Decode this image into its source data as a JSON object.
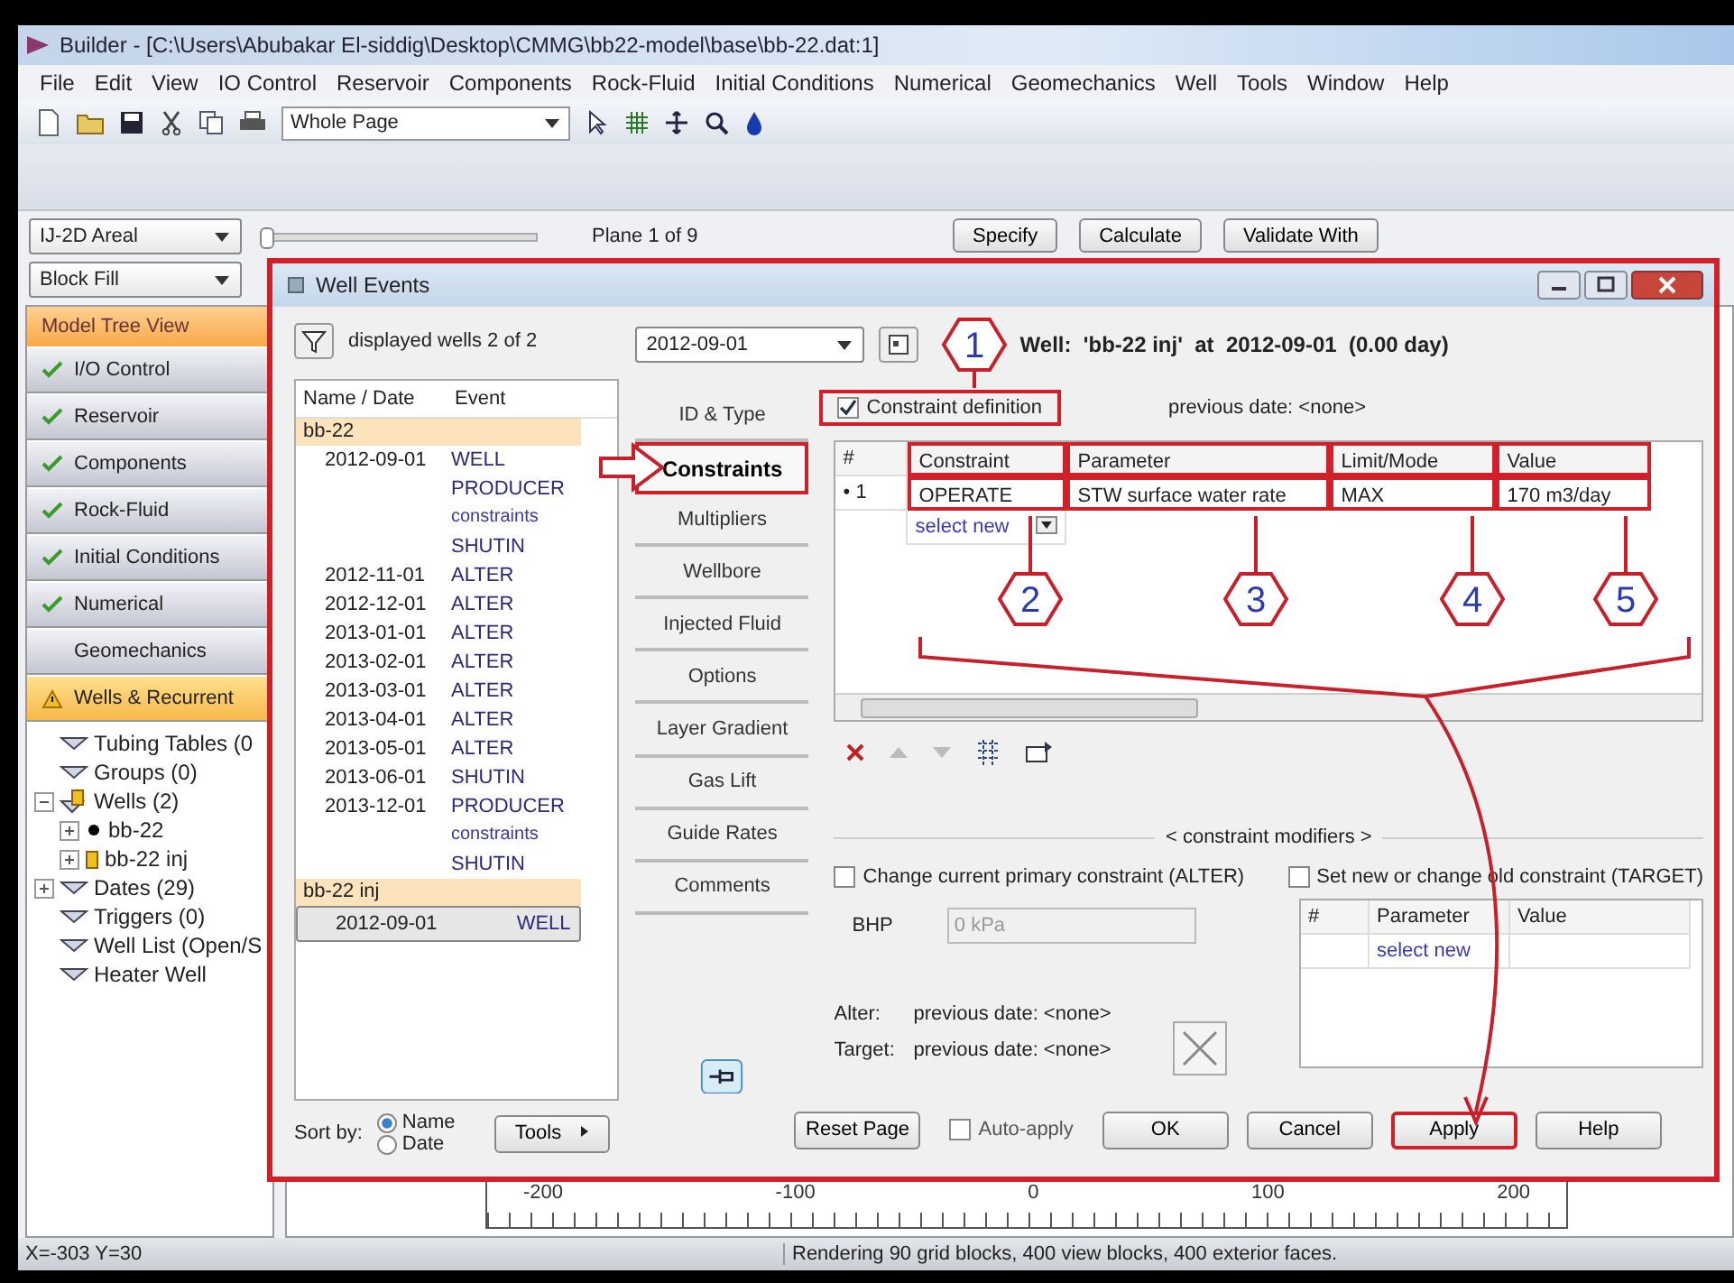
{
  "window": {
    "title": "Builder - [C:\\Users\\Abubakar El-siddig\\Desktop\\CMMG\\bb22-model\\base\\bb-22.dat:1]"
  },
  "menu": [
    "File",
    "Edit",
    "View",
    "IO Control",
    "Reservoir",
    "Components",
    "Rock-Fluid",
    "Initial Conditions",
    "Numerical",
    "Geomechanics",
    "Well",
    "Tools",
    "Window",
    "Help"
  ],
  "toolbar": {
    "zoom_select": "Whole Page"
  },
  "view_controls": {
    "view_select": "IJ-2D Areal",
    "fill_select": "Block Fill",
    "plane_slider": {
      "level": 0
    },
    "plane_label": "Plane 1 of 9",
    "buttons": [
      "Specify",
      "Calculate",
      "Validate With"
    ]
  },
  "sidebar": {
    "header": "Model Tree View",
    "sections": [
      {
        "label": "I/O Control",
        "checked": true,
        "warning": false,
        "selected": false
      },
      {
        "label": "Reservoir",
        "checked": true,
        "warning": false,
        "selected": false
      },
      {
        "label": "Components",
        "checked": true,
        "warning": false,
        "selected": false
      },
      {
        "label": "Rock-Fluid",
        "checked": true,
        "warning": false,
        "selected": false
      },
      {
        "label": "Initial Conditions",
        "checked": true,
        "warning": false,
        "selected": false
      },
      {
        "label": "Numerical",
        "checked": true,
        "warning": false,
        "selected": false
      },
      {
        "label": "Geomechanics",
        "checked": false,
        "warning": false,
        "selected": false
      },
      {
        "label": "Wells & Recurrent",
        "checked": false,
        "warning": true,
        "selected": true
      }
    ],
    "tree": [
      {
        "label": "Tubing Tables (0",
        "kind": "group"
      },
      {
        "label": "Groups (0)",
        "kind": "group"
      },
      {
        "label": "Wells (2)",
        "kind": "wells",
        "expanded": true,
        "children": [
          {
            "label": "bb-22",
            "kind": "producer",
            "expanded": false
          },
          {
            "label": "bb-22 inj",
            "kind": "injector",
            "expanded": false
          }
        ]
      },
      {
        "label": "Dates (29)",
        "kind": "group",
        "expanded": false
      },
      {
        "label": "Triggers (0)",
        "kind": "group"
      },
      {
        "label": "Well List (Open/S",
        "kind": "group"
      },
      {
        "label": "Heater Well",
        "kind": "group"
      }
    ]
  },
  "canvas": {
    "ruler_labels": [
      "-200",
      "-100",
      "0",
      "100",
      "200"
    ]
  },
  "status_bar": {
    "coords": "X=-303 Y=30",
    "message": "Rendering 90 grid blocks, 400 view blocks, 400 exterior faces."
  },
  "dialog": {
    "title": "Well Events",
    "filter_label": "displayed wells 2 of 2",
    "list": {
      "columns": [
        "Name / Date",
        "Event"
      ],
      "wells": [
        {
          "name": "bb-22",
          "dates": [
            {
              "date": "2012-09-01",
              "selected": false,
              "events": [
                {
                  "text": "WELL",
                  "kind": "keyword"
                },
                {
                  "text": "PRODUCER",
                  "kind": "keyword"
                },
                {
                  "text": "constraints",
                  "kind": "sub"
                },
                {
                  "text": "SHUTIN",
                  "kind": "keyword"
                }
              ]
            },
            {
              "date": "2012-11-01",
              "selected": false,
              "events": [
                {
                  "text": "ALTER",
                  "kind": "keyword"
                }
              ]
            },
            {
              "date": "2012-12-01",
              "selected": false,
              "events": [
                {
                  "text": "ALTER",
                  "kind": "keyword"
                }
              ]
            },
            {
              "date": "2013-01-01",
              "selected": false,
              "events": [
                {
                  "text": "ALTER",
                  "kind": "keyword"
                }
              ]
            },
            {
              "date": "2013-02-01",
              "selected": false,
              "events": [
                {
                  "text": "ALTER",
                  "kind": "keyword"
                }
              ]
            },
            {
              "date": "2013-03-01",
              "selected": false,
              "events": [
                {
                  "text": "ALTER",
                  "kind": "keyword"
                }
              ]
            },
            {
              "date": "2013-04-01",
              "selected": false,
              "events": [
                {
                  "text": "ALTER",
                  "kind": "keyword"
                }
              ]
            },
            {
              "date": "2013-05-01",
              "selected": false,
              "events": [
                {
                  "text": "ALTER",
                  "kind": "keyword"
                }
              ]
            },
            {
              "date": "2013-06-01",
              "selected": false,
              "events": [
                {
                  "text": "SHUTIN",
                  "kind": "keyword"
                }
              ]
            },
            {
              "date": "2013-12-01",
              "selected": false,
              "events": [
                {
                  "text": "PRODUCER",
                  "kind": "keyword"
                },
                {
                  "text": "constraints",
                  "kind": "sub"
                },
                {
                  "text": "SHUTIN",
                  "kind": "keyword"
                }
              ]
            }
          ]
        },
        {
          "name": "bb-22 inj",
          "dates": [
            {
              "date": "2012-09-01",
              "selected": true,
              "events": [
                {
                  "text": "WELL",
                  "kind": "keyword"
                }
              ]
            }
          ]
        }
      ]
    },
    "sort": {
      "label": "Sort by:",
      "options": [
        {
          "label": "Name",
          "selected": true
        },
        {
          "label": "Date",
          "selected": false
        }
      ]
    },
    "tools_button": "Tools",
    "date_select": "2012-09-01",
    "well_info": "Well:  'bb-22 inj'  at  2012-09-01  (0.00 day)",
    "tabs": [
      {
        "label": "ID & Type",
        "selected": false
      },
      {
        "label": "Constraints",
        "selected": true
      },
      {
        "label": "Multipliers",
        "selected": false
      },
      {
        "label": "Wellbore",
        "selected": false
      },
      {
        "label": "Injected Fluid",
        "selected": false
      },
      {
        "label": "Options",
        "selected": false
      },
      {
        "label": "Layer Gradient",
        "selected": false
      },
      {
        "label": "Gas Lift",
        "selected": false
      },
      {
        "label": "Guide Rates",
        "selected": false
      },
      {
        "label": "Comments",
        "selected": false
      }
    ],
    "constraint_definition": {
      "label": "Constraint definition",
      "checked": true
    },
    "previous_date": "previous date: <none>",
    "constraints_table": {
      "columns": [
        "#",
        "Constraint",
        "Parameter",
        "Limit/Mode",
        "Value"
      ],
      "rows": [
        {
          "marker": "•",
          "cells": [
            "1",
            "OPERATE",
            "STW surface water rate",
            "MAX",
            "170  m3/day"
          ]
        }
      ],
      "select_new": "select new"
    },
    "modifiers": {
      "title": "< constraint modifiers >",
      "alter": {
        "label": "Change current primary constraint (ALTER)",
        "checked": false
      },
      "target": {
        "label": "Set new or change old constraint (TARGET)",
        "checked": false
      },
      "bhp_label": "BHP",
      "bhp_value": "0 kPa",
      "bhp_disabled": true,
      "target_table": {
        "columns": [
          "#",
          "Parameter",
          "Value"
        ],
        "select_new": "select new"
      },
      "alter_label": "Alter:",
      "alter_previous": "previous date: <none>",
      "target_label": "Target:",
      "target_previous": "previous date: <none>"
    },
    "buttons": [
      {
        "label": "Reset Page",
        "kind": "button",
        "highlighted": false
      },
      {
        "label": "Auto-apply",
        "kind": "checkbox",
        "checked": false
      },
      {
        "label": "OK",
        "kind": "button",
        "highlighted": false
      },
      {
        "label": "Cancel",
        "kind": "button",
        "highlighted": false
      },
      {
        "label": "Apply",
        "kind": "button",
        "highlighted": true
      },
      {
        "label": "Help",
        "kind": "button",
        "highlighted": false
      }
    ],
    "callouts": [
      "1",
      "2",
      "3",
      "4",
      "5"
    ]
  }
}
